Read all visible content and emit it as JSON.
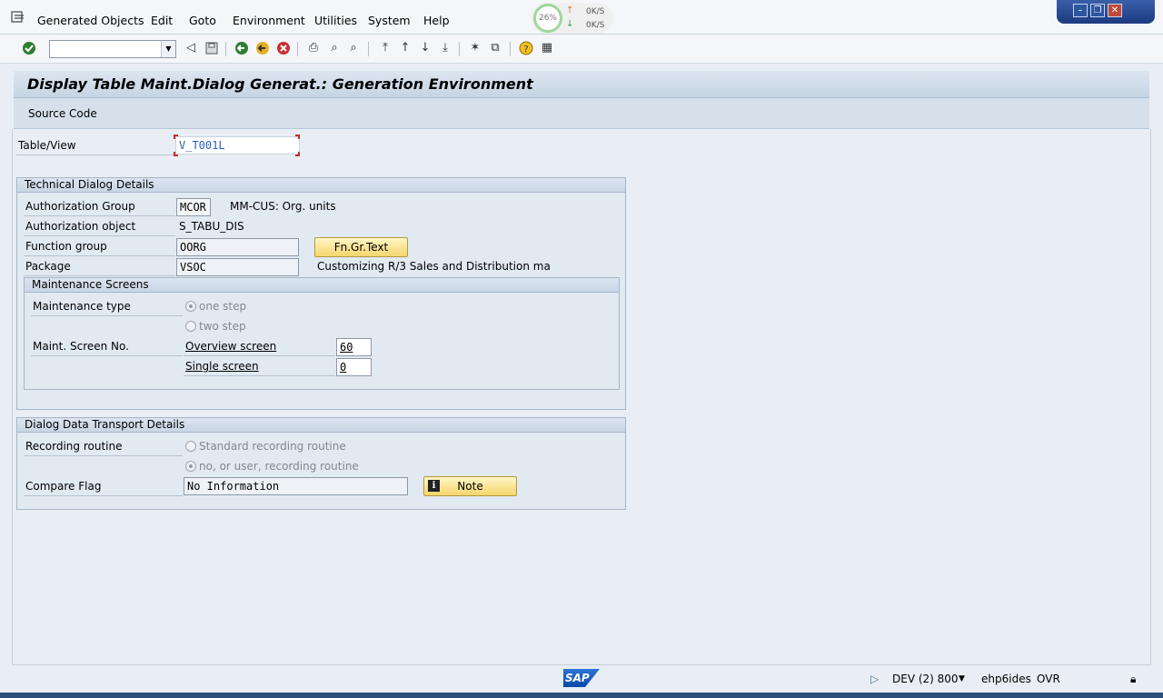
{
  "menu": {
    "items": [
      {
        "label": "Generated Objects"
      },
      {
        "label": "Edit"
      },
      {
        "label": "Goto"
      },
      {
        "label": "Environment"
      },
      {
        "label": "Utilities"
      },
      {
        "label": "System"
      },
      {
        "label": "Help"
      }
    ]
  },
  "net_meter": {
    "percent": "26%",
    "up": "0K/S",
    "down": "0K/S"
  },
  "toolbar": {
    "command_value": ""
  },
  "page": {
    "title": "Display Table Maint.Dialog Generat.: Generation Environment"
  },
  "app_toolbar": {
    "source_code": "Source Code"
  },
  "table_view": {
    "label": "Table/View",
    "value": "V_T001L"
  },
  "technical": {
    "header": "Technical Dialog Details",
    "auth_group_label": "Authorization Group",
    "auth_group_value": "MCOR",
    "auth_group_text": "MM-CUS: Org. units",
    "auth_object_label": "Authorization object",
    "auth_object_value": "S_TABU_DIS",
    "function_group_label": "Function group",
    "function_group_value": "OORG",
    "fn_gr_text_button": "Fn.Gr.Text",
    "package_label": "Package",
    "package_value": "VSOC",
    "package_text": "Customizing R/3 Sales and Distribution ma"
  },
  "maintenance": {
    "header": "Maintenance Screens",
    "type_label": "Maintenance type",
    "one_step": "one step",
    "two_step": "two step",
    "screen_no_label": "Maint. Screen No.",
    "overview_label": "Overview screen",
    "overview_value": "60",
    "single_label": "Single screen",
    "single_value": "0"
  },
  "transport": {
    "header": "Dialog Data Transport Details",
    "recording_label": "Recording routine",
    "standard_routine": "Standard recording routine",
    "no_routine": "no, or user, recording routine",
    "compare_label": "Compare Flag",
    "compare_value": "No Information",
    "note_button": "Note"
  },
  "status": {
    "system": "DEV (2) 800",
    "server": "ehp6ides",
    "mode": "OVR"
  },
  "logo": {
    "text": "SAP"
  }
}
